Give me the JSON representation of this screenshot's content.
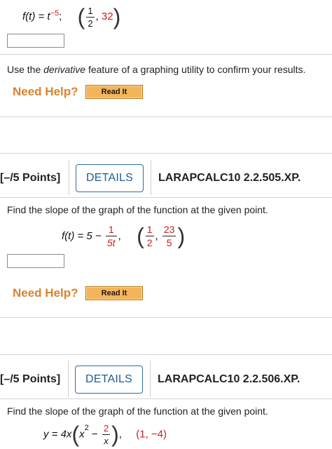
{
  "problem1": {
    "func_left": "f(t) = t",
    "exponent": "−5",
    "semicolon": ";",
    "point_num": "1",
    "point_den": "2",
    "point_second": "32",
    "instruction_pre": "Use the ",
    "instruction_em": "derivative",
    "instruction_post": " feature of a graphing utility to confirm your results.",
    "need_help": "Need Help?",
    "read_it": "Read It"
  },
  "problem2": {
    "points": "[–/5 Points]",
    "details": "DETAILS",
    "code": "LARAPCALC10 2.2.505.XP.",
    "prompt": "Find the slope of the graph of the function at the given point.",
    "func_left": "f(t) = 5 −",
    "frac_num": "1",
    "frac_den": "5t",
    "comma": ",",
    "point_x_num": "1",
    "point_x_den": "2",
    "point_y_num": "23",
    "point_y_den": "5",
    "need_help": "Need Help?",
    "read_it": "Read It"
  },
  "problem3": {
    "points": "[–/5 Points]",
    "details": "DETAILS",
    "code": "LARAPCALC10 2.2.506.XP.",
    "prompt": "Find the slope of the graph of the function at the given point.",
    "func_left": "y = 4x",
    "inner_x": "x",
    "inner_exp": "2",
    "inner_minus": "−",
    "frac_num": "2",
    "frac_den": "x",
    "comma": ",",
    "point": "(1, −4)"
  },
  "colors": {
    "need_help": "#d9822b",
    "read_it_bg": "#f4b55a",
    "details_border": "#2e6da4",
    "point_red": "#c81e1e"
  }
}
